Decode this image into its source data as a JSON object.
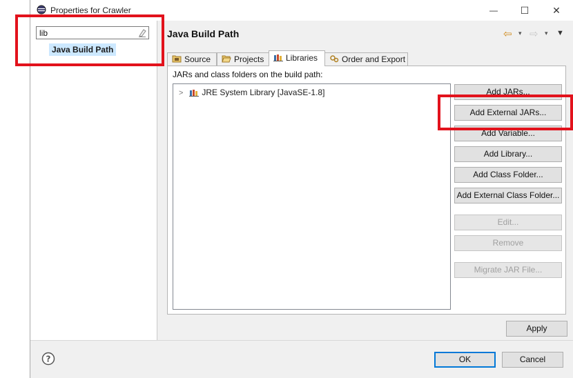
{
  "window": {
    "title": "Properties for Crawler",
    "minimize_glyph": "—",
    "maximize_glyph": "☐",
    "close_glyph": "✕"
  },
  "sidebar": {
    "filter_value": "lib",
    "selected_item": "Java Build Path"
  },
  "page": {
    "title": "Java Build Path",
    "back_glyph": "⇦",
    "forward_glyph": "⇨",
    "dropdown_glyph": "▾",
    "menu_glyph": "▼"
  },
  "tabs": [
    {
      "label": "Source",
      "icon": "source-folder-icon"
    },
    {
      "label": "Projects",
      "icon": "open-folder-icon"
    },
    {
      "label": "Libraries",
      "icon": "library-books-icon",
      "active": true
    },
    {
      "label": "Order and Export",
      "icon": "order-export-icon"
    }
  ],
  "libraries": {
    "description": "JARs and class folders on the build path:",
    "entries": [
      {
        "label": "JRE System Library [JavaSE-1.8]",
        "expand_glyph": ">"
      }
    ]
  },
  "buttons": {
    "add_jars": "Add JARs...",
    "add_external_jars": "Add External JARs...",
    "add_variable": "Add Variable...",
    "add_library": "Add Library...",
    "add_class_folder": "Add Class Folder...",
    "add_external_class_folder": "Add External Class Folder...",
    "edit": "Edit...",
    "remove": "Remove",
    "migrate_jar": "Migrate JAR File...",
    "apply": "Apply",
    "ok": "OK",
    "cancel": "Cancel",
    "help_glyph": "?"
  },
  "colors": {
    "highlight_red": "#e2121c",
    "selection_blue": "#cce8ff",
    "default_button_border": "#0078d7"
  }
}
